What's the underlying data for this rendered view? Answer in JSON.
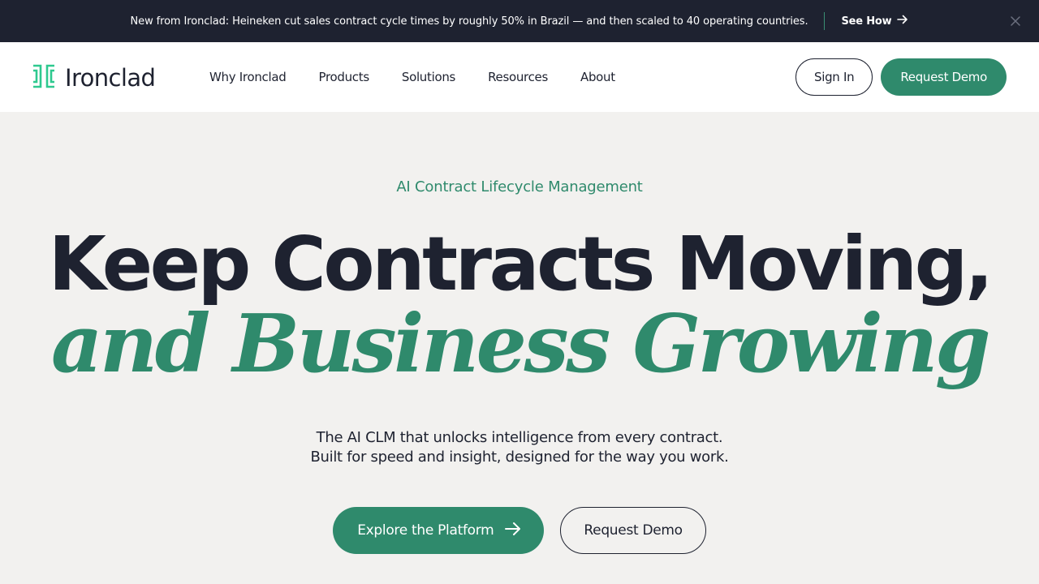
{
  "announcement": {
    "message": "New from Ironclad: Heineken cut sales contract cycle times by roughly 50% in Brazil — and then scaled to 40 operating countries.",
    "link_label": "See How"
  },
  "nav": {
    "logo_text": "Ironclad",
    "links": [
      "Why Ironclad",
      "Products",
      "Solutions",
      "Resources",
      "About"
    ],
    "sign_in_label": "Sign In",
    "request_demo_label": "Request Demo"
  },
  "hero": {
    "eyebrow": "AI Contract Lifecycle Management",
    "headline_line1": "Keep Contracts Moving,",
    "headline_line2": "and Business Growing",
    "subtext_line1": "The AI CLM that unlocks intelligence from every contract.",
    "subtext_line2": "Built for speed and insight, designed for the way you work.",
    "primary_cta": "Explore the Platform",
    "secondary_cta": "Request Demo"
  },
  "icons": {
    "logo": "ironclad-logo-icon",
    "link_arrow": "arrow-right-icon",
    "close": "close-icon"
  },
  "colors": {
    "brand_green": "#2f8a6c",
    "dark_navy": "#1e2230",
    "hero_background": "#f2f1ef",
    "logo_green": "#2ec98f"
  }
}
